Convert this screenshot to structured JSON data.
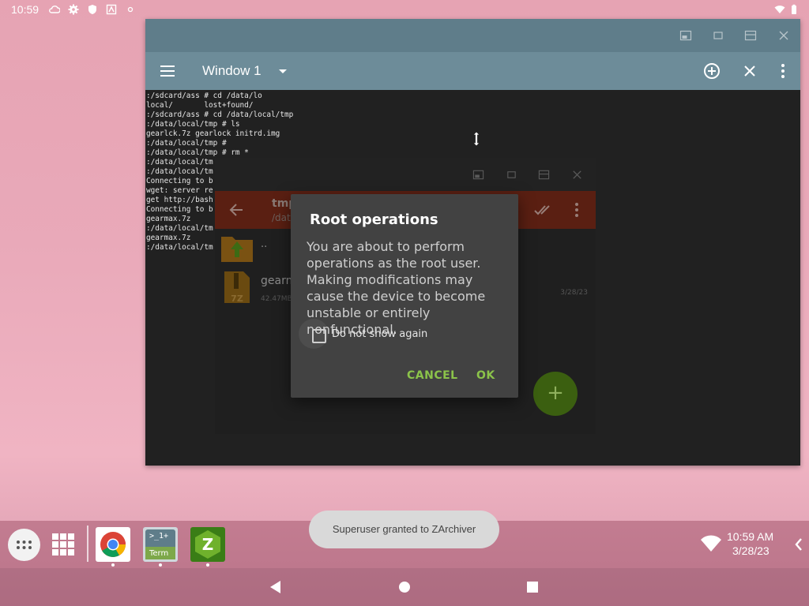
{
  "status_bar": {
    "time": "10:59",
    "icons": [
      "cloud-icon",
      "gear-icon",
      "shield-icon",
      "zarchiver-notify-icon",
      "dot-icon"
    ],
    "right_icons": [
      "wifi-icon",
      "battery-icon"
    ]
  },
  "terminal": {
    "window_title": "Window 1",
    "lines": [
      ":/sdcard/ass # cd /data/lo",
      "local/       lost+found/",
      ":/sdcard/ass # cd /data/local/tmp",
      ":/data/local/tmp # ls",
      "gearlck.7z gearlock initrd.img",
      ":/data/local/tmp #",
      ":/data/local/tmp # rm *",
      ":/data/local/tm",
      ":/data/local/tm",
      "Connecting to b",
      "wget: server re",
      "get http://bash",
      "Connecting to b",
      "gearmax.7z",
      ":/data/local/tm",
      "gearmax.7z",
      ":/data/local/tm"
    ]
  },
  "zarchiver": {
    "path_title": "tmp",
    "path_sub": "/dat",
    "files": [
      {
        "name": "..",
        "size": "",
        "date": ""
      },
      {
        "name": "gearm",
        "size": "42.47MB",
        "date": "3/28/23"
      }
    ],
    "fab_label": "+"
  },
  "dialog": {
    "title": "Root operations",
    "message": "You are about to perform operations as the root user. Making modifications may cause the device to become unstable or entirely nonfunctional.",
    "checkbox_label": "Do not show again",
    "checkbox_checked": false,
    "cancel_label": "CANCEL",
    "ok_label": "OK"
  },
  "toast": "Superuser granted to ZArchiver",
  "taskbar": {
    "apps": [
      {
        "name": "Chrome",
        "icon": "chrome-icon"
      },
      {
        "name": "Term",
        "icon_text": ">_1+ Term"
      },
      {
        "name": "ZArchiver",
        "icon_text": "Z"
      }
    ],
    "term_icon_top": ">_1+",
    "term_icon_bottom": "Term",
    "za_icon_text": "Z",
    "clock_time": "10:59 AM",
    "clock_date": "3/28/23"
  },
  "colors": {
    "accent_green": "#8bc34a",
    "terminal_appbar": "#6d8c99",
    "zarchiver_toolbar": "#5a1f12"
  }
}
